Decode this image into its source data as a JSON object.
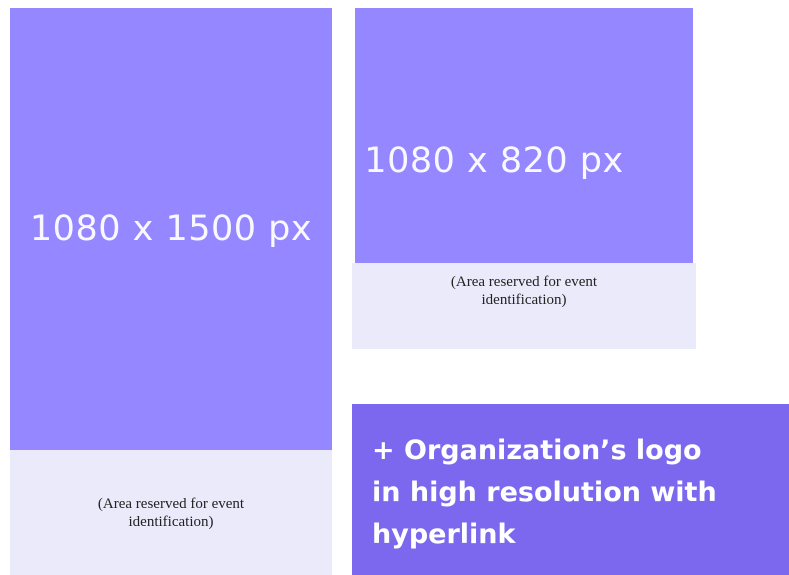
{
  "left_card": {
    "dimension_label": "1080 x 1500 px",
    "caption": "(Area reserved for event identification)"
  },
  "right_card": {
    "dimension_label": "1080 x 820 px",
    "caption": "(Area reserved for event identification)"
  },
  "logo_box": {
    "text": "+ Organization’s logo in high resolution with hyperlink"
  },
  "colors": {
    "placeholder_fill": "#9587ff",
    "caption_fill": "#eaeafb",
    "logo_box_fill": "#7b68ee"
  }
}
